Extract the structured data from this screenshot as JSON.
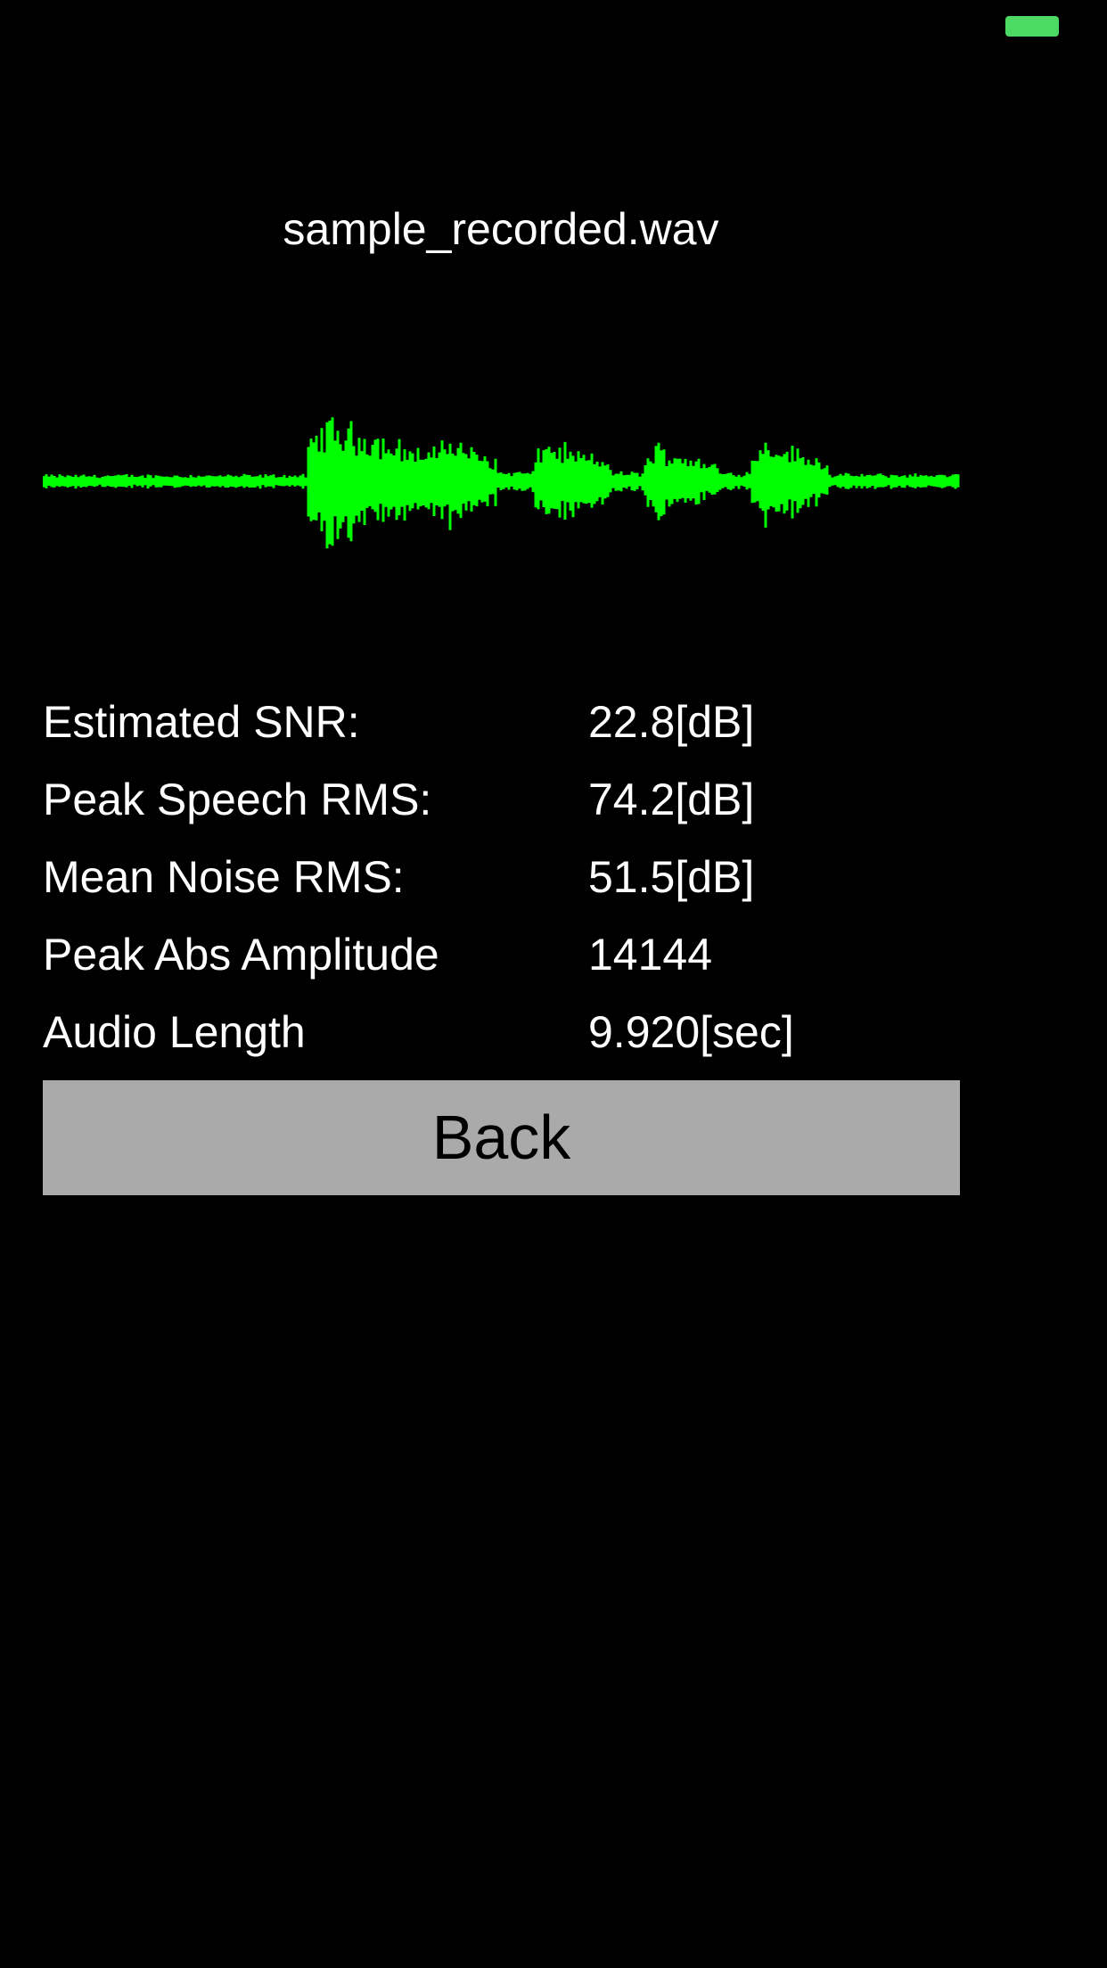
{
  "status_bar": {
    "battery_color": "#4cd964"
  },
  "file": {
    "name": "sample_recorded.wav"
  },
  "waveform": {
    "color": "#00ff00",
    "duration_sec": 9.92,
    "segments": [
      {
        "start": 0.0,
        "end": 2.85,
        "amplitude": 0.1
      },
      {
        "start": 2.85,
        "end": 4.2,
        "amplitude": 0.95
      },
      {
        "start": 4.2,
        "end": 4.9,
        "amplitude": 0.72
      },
      {
        "start": 4.9,
        "end": 5.3,
        "amplitude": 0.15
      },
      {
        "start": 5.3,
        "end": 6.15,
        "amplitude": 0.62
      },
      {
        "start": 6.15,
        "end": 6.5,
        "amplitude": 0.14
      },
      {
        "start": 6.5,
        "end": 7.3,
        "amplitude": 0.55
      },
      {
        "start": 7.3,
        "end": 7.65,
        "amplitude": 0.14
      },
      {
        "start": 7.65,
        "end": 8.5,
        "amplitude": 0.66
      },
      {
        "start": 8.5,
        "end": 9.92,
        "amplitude": 0.11
      }
    ]
  },
  "stats": [
    {
      "label": "Estimated SNR:",
      "value": "22.8[dB]"
    },
    {
      "label": "Peak Speech RMS:",
      "value": "74.2[dB]"
    },
    {
      "label": "Mean Noise RMS:",
      "value": "51.5[dB]"
    },
    {
      "label": "Peak Abs Amplitude",
      "value": "14144"
    },
    {
      "label": "Audio Length",
      "value": "9.920[sec]"
    }
  ],
  "back_button": {
    "label": "Back",
    "background": "#aaaaaa"
  }
}
